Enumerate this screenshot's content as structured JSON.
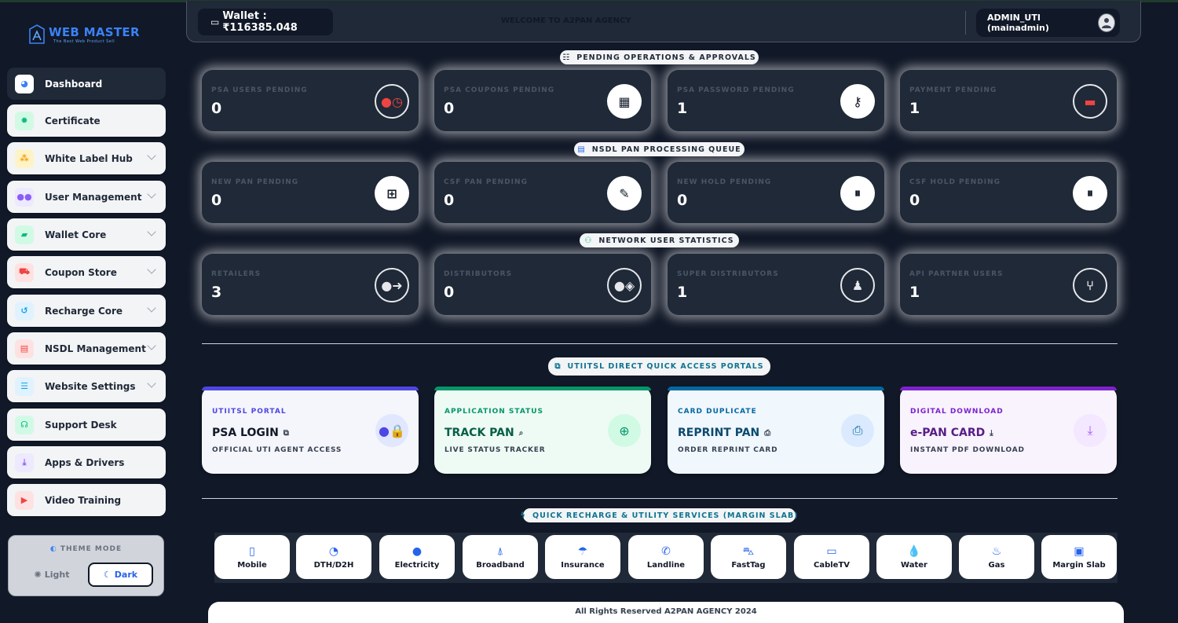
{
  "brand": {
    "title": "WEB MASTER",
    "tagline": "The Best Web Product Sell"
  },
  "sidebar": {
    "items": [
      {
        "label": "Dashboard",
        "icon": "gauge-icon",
        "color": "#3b82f6"
      },
      {
        "label": "Certificate",
        "icon": "badge-icon",
        "color": "#10b981"
      },
      {
        "label": "White Label Hub",
        "icon": "sitemap-icon",
        "color": "#f59e0b"
      },
      {
        "label": "User Management",
        "icon": "users-icon",
        "color": "#8b5cf6"
      },
      {
        "label": "Wallet Core",
        "icon": "wallet-icon",
        "color": "#10b981"
      },
      {
        "label": "Coupon Store",
        "icon": "cart-icon",
        "color": "#ef4444"
      },
      {
        "label": "Recharge Core",
        "icon": "history-icon",
        "color": "#0ea5e9"
      },
      {
        "label": "NSDL Management",
        "icon": "id-card-icon",
        "color": "#ef4444"
      },
      {
        "label": "Website Settings",
        "icon": "sliders-icon",
        "color": "#0ea5e9"
      },
      {
        "label": "Support Desk",
        "icon": "headset-icon",
        "color": "#10b981"
      },
      {
        "label": "Apps & Drivers",
        "icon": "download-icon",
        "color": "#8b5cf6"
      },
      {
        "label": "Video Training",
        "icon": "youtube-icon",
        "color": "#ef4444"
      }
    ],
    "theme": {
      "title": "THEME MODE",
      "light": "Light",
      "dark": "Dark"
    }
  },
  "header": {
    "wallet": "Wallet : ₹116385.048",
    "welcome": "WELCOME TO A2PAN AGENCY",
    "user": "ADMIN_UTI (mainadmin)"
  },
  "sections": {
    "pending": "PENDING OPERATIONS & APPROVALS",
    "nsdl": "NSDL PAN PROCESSING QUEUE",
    "network": "NETWORK USER STATISTICS",
    "portals": "UTIITSL DIRECT QUICK ACCESS PORTALS",
    "services": "QUICK RECHARGE & UTILITY SERVICES (MARGIN SLAB)"
  },
  "stats": {
    "pending": [
      {
        "label": "PSA USERS PENDING",
        "value": "0",
        "icon": "user-clock-icon"
      },
      {
        "label": "PSA COUPONS PENDING",
        "value": "0",
        "icon": "qrcode-icon"
      },
      {
        "label": "PSA PASSWORD PENDING",
        "value": "1",
        "icon": "key-icon"
      },
      {
        "label": "PAYMENT PENDING",
        "value": "1",
        "icon": "money-bill-icon"
      }
    ],
    "nsdl": [
      {
        "label": "NEW PAN PENDING",
        "value": "0",
        "icon": "plus-square-icon"
      },
      {
        "label": "CSF PAN PENDING",
        "value": "0",
        "icon": "edit-icon"
      },
      {
        "label": "NEW HOLD PENDING",
        "value": "0",
        "icon": "pause-icon"
      },
      {
        "label": "CSF HOLD PENDING",
        "value": "0",
        "icon": "pause-icon"
      }
    ],
    "network": [
      {
        "label": "RETAILERS",
        "value": "3",
        "icon": "user-arrow-icon"
      },
      {
        "label": "DISTRIBUTORS",
        "value": "0",
        "icon": "user-tag-icon"
      },
      {
        "label": "SUPER DISTRIBUTORS",
        "value": "1",
        "icon": "user-tie-icon"
      },
      {
        "label": "API PARTNER USERS",
        "value": "1",
        "icon": "code-branch-icon"
      }
    ]
  },
  "portals": [
    {
      "category": "UTIITSL PORTAL",
      "title": "PSA LOGIN",
      "subtitle": "OFFICIAL UTI AGENT ACCESS",
      "accent": "#4f46e5",
      "icon": "user-lock-icon",
      "title_icon": "external-link-icon"
    },
    {
      "category": "APPLICATION STATUS",
      "title": "TRACK PAN",
      "subtitle": "LIVE STATUS TRACKER",
      "accent": "#059669",
      "icon": "search-plus-icon",
      "title_icon": "search-icon"
    },
    {
      "category": "CARD DUPLICATE",
      "title": "REPRINT PAN",
      "subtitle": "ORDER REPRINT CARD",
      "accent": "#0369a1",
      "icon": "print-icon",
      "title_icon": "print-icon"
    },
    {
      "category": "DIGITAL DOWNLOAD",
      "title": "e-PAN CARD",
      "subtitle": "INSTANT PDF DOWNLOAD",
      "accent": "#7e22ce",
      "icon": "download-icon",
      "title_icon": "download-icon"
    }
  ],
  "services": [
    {
      "label": "Mobile",
      "icon": "mobile-icon"
    },
    {
      "label": "DTH/D2H",
      "icon": "satellite-dish-icon"
    },
    {
      "label": "Electricity",
      "icon": "lightbulb-icon"
    },
    {
      "label": "Broadband",
      "icon": "broadcast-tower-icon"
    },
    {
      "label": "Insurance",
      "icon": "umbrella-icon"
    },
    {
      "label": "Landline",
      "icon": "phone-icon"
    },
    {
      "label": "FastTag",
      "icon": "car-icon"
    },
    {
      "label": "CableTV",
      "icon": "tv-icon"
    },
    {
      "label": "Water",
      "icon": "tint-icon"
    },
    {
      "label": "Gas",
      "icon": "fire-icon"
    },
    {
      "label": "Margin Slab",
      "icon": "money-icon"
    }
  ],
  "footer": "All Rights Reserved A2PAN AGENCY 2024"
}
